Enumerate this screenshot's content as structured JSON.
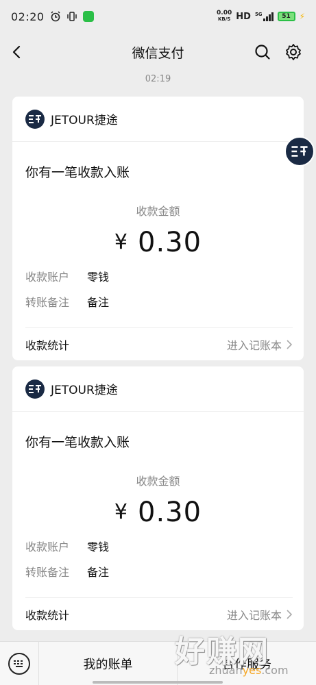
{
  "status_bar": {
    "time": "02:20",
    "net_speed_value": "0.00",
    "net_speed_unit": "KB/S",
    "hd": "HD",
    "network": "5G",
    "battery": "51"
  },
  "nav": {
    "title": "微信支付"
  },
  "chat": {
    "timestamp": "02:19"
  },
  "cards": [
    {
      "merchant": "JETOUR捷途",
      "message": "你有一笔收款入账",
      "amount_label": "收款金额",
      "currency": "¥",
      "amount": "0.30",
      "account_label": "收款账户",
      "account_value": "零钱",
      "remark_label": "转账备注",
      "remark_value": "备注",
      "stats_label": "收款统计",
      "ledger_link": "进入记账本"
    },
    {
      "merchant": "JETOUR捷途",
      "message": "你有一笔收款入账",
      "amount_label": "收款金额",
      "currency": "¥",
      "amount": "0.30",
      "account_label": "收款账户",
      "account_value": "零钱",
      "remark_label": "转账备注",
      "remark_value": "备注",
      "stats_label": "收款统计",
      "ledger_link": "进入记账本"
    }
  ],
  "bottom_bar": {
    "bill_tab": "我的账单",
    "second_tab": "合作服务"
  },
  "watermark": {
    "big": "好赚网",
    "small_prefix": "zhuan",
    "small_highlight": "yes",
    "small_suffix": ".com"
  },
  "colors": {
    "background": "#ededed",
    "card": "#ffffff",
    "logo": "#1a2a44",
    "wechat_green": "#2bbf47"
  }
}
